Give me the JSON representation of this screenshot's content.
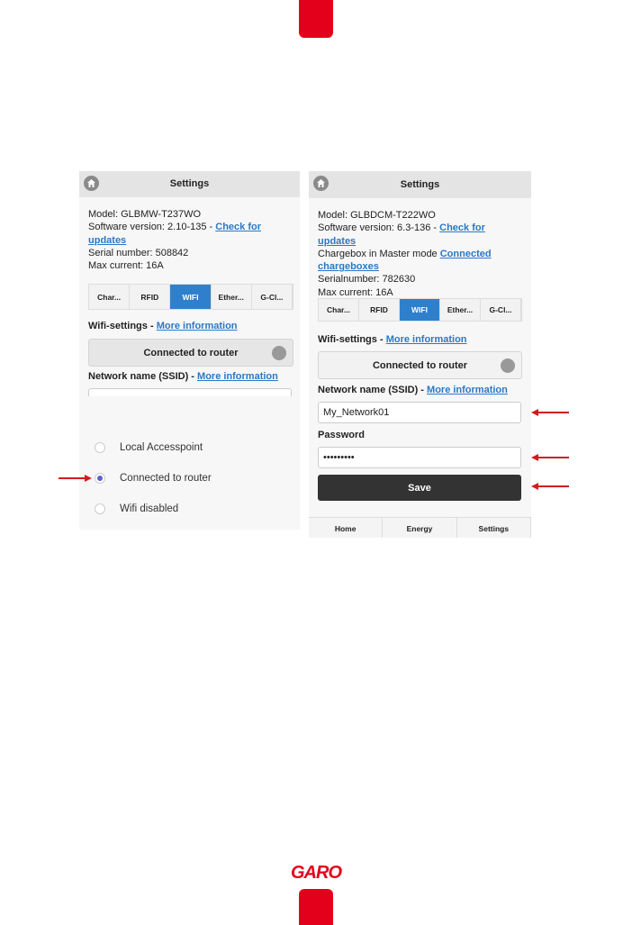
{
  "brand": {
    "logo_text": "GARO",
    "color": "#e3001b"
  },
  "left_screen": {
    "title": "Settings",
    "model": "Model: GLBMW-T237WO",
    "software_prefix": "Software version: 2.10-135 - ",
    "software_link": "Check for updates",
    "serial": "Serial number: 508842",
    "max_current": "Max current: 16A",
    "tabs": [
      "Char...",
      "RFID",
      "WIFI",
      "Ether...",
      "G-Cl..."
    ],
    "active_tab": "WIFI",
    "wifi_label": "Wifi-settings - ",
    "wifi_link": "More information",
    "wifi_mode": "Connected to router",
    "ssid_label": "Network name (SSID) - ",
    "ssid_link": "More information",
    "options": [
      "Local Accesspoint",
      "Connected to router",
      "Wifi disabled"
    ],
    "selected_option": "Connected to router"
  },
  "right_screen": {
    "title": "Settings",
    "model": "Model: GLBDCM-T222WO",
    "software_prefix": "Software version: 6.3-136 - ",
    "software_link": "Check for updates",
    "master_prefix": "Chargebox in Master mode ",
    "master_link": "Connected chargeboxes",
    "serial": "Serialnumber: 782630",
    "max_current": "Max current: 16A",
    "tabs": [
      "Char...",
      "RFID",
      "WIFI",
      "Ether...",
      "G-Cl..."
    ],
    "active_tab": "WIFI",
    "wifi_label": "Wifi-settings - ",
    "wifi_link": "More information",
    "wifi_mode": "Connected to router",
    "ssid_label": "Network name (SSID) - ",
    "ssid_link": "More information",
    "ssid_value": "My_Network01",
    "password_label": "Password",
    "password_value": "•••••••••",
    "save_label": "Save",
    "nav": [
      "Home",
      "Energy",
      "Settings"
    ]
  }
}
